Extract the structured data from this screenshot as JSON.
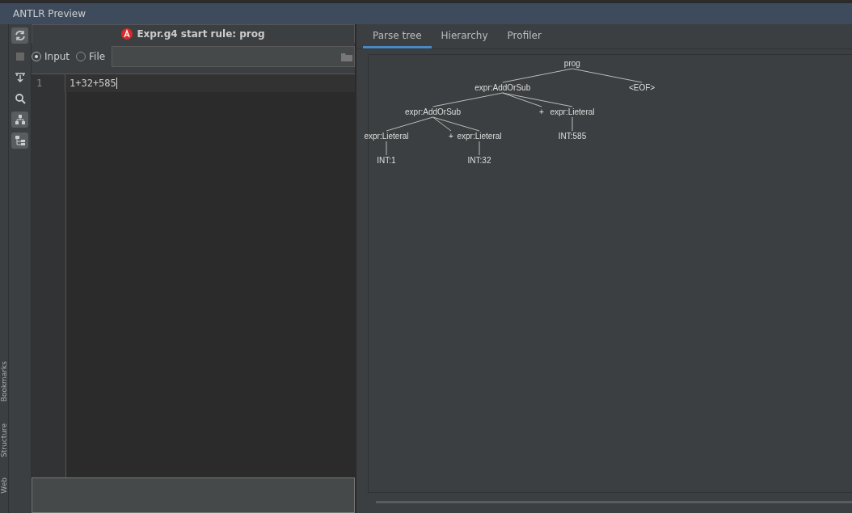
{
  "window": {
    "title": "ANTLR Preview"
  },
  "side_tabs": [
    "Bookmarks",
    "Structure",
    "Web"
  ],
  "header": {
    "title": "Expr.g4 start rule: prog"
  },
  "source": {
    "options": [
      {
        "label": "Input",
        "selected": true
      },
      {
        "label": "File",
        "selected": false
      }
    ]
  },
  "editor": {
    "lines": [
      {
        "number": "1",
        "text": "1+32+585"
      }
    ]
  },
  "tabs": [
    {
      "label": "Parse tree",
      "selected": true
    },
    {
      "label": "Hierarchy",
      "selected": false
    },
    {
      "label": "Profiler",
      "selected": false
    }
  ],
  "parse_tree": {
    "label": "prog",
    "children": [
      {
        "label": "expr:AddOrSub",
        "children": [
          {
            "label": "expr:AddOrSub",
            "children": [
              {
                "label": "expr:Lieteral",
                "children": [
                  {
                    "label": "INT:1"
                  }
                ]
              },
              {
                "label": "+"
              },
              {
                "label": "expr:Lieteral",
                "children": [
                  {
                    "label": "INT:32"
                  }
                ]
              }
            ]
          },
          {
            "label": "+"
          },
          {
            "label": "expr:Lieteral",
            "children": [
              {
                "label": "INT:585"
              }
            ]
          }
        ]
      },
      {
        "label": "<EOF>"
      }
    ]
  }
}
